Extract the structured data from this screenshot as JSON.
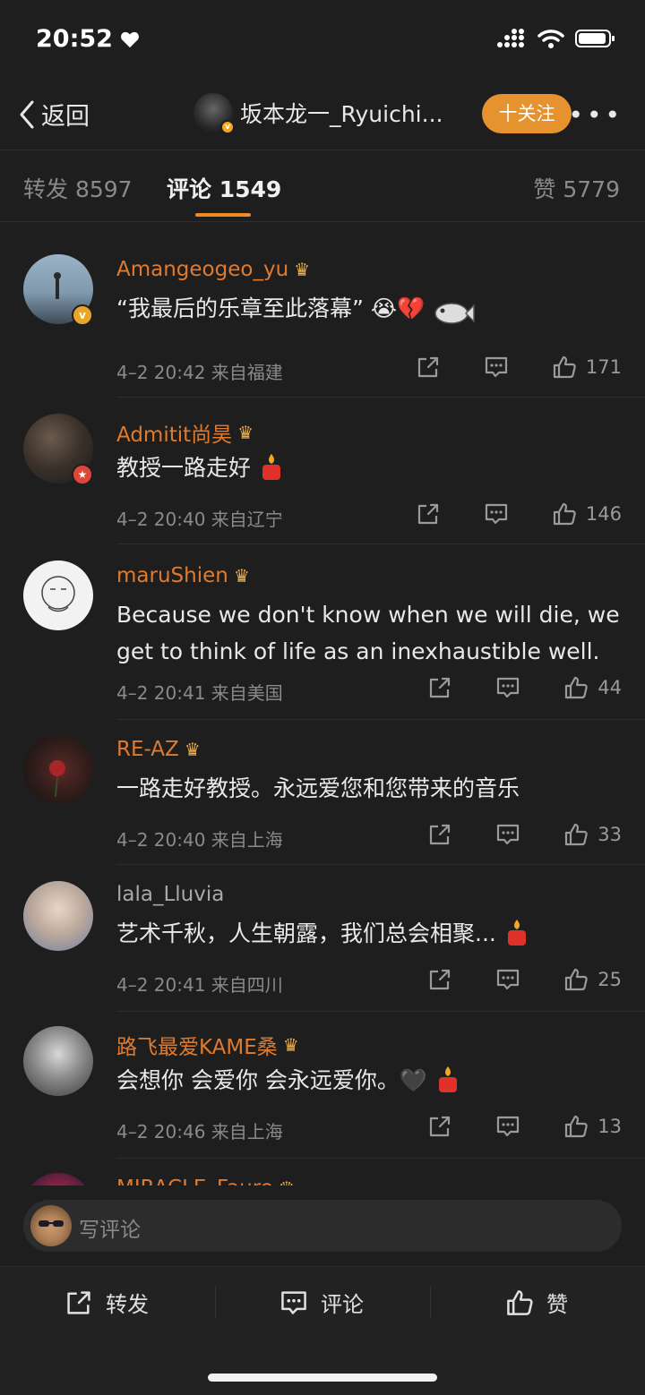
{
  "status_bar": {
    "time": "20:52"
  },
  "nav": {
    "back_label": "返回",
    "user_name": "坂本龙一_Ryuichi...",
    "follow_label": "十关注",
    "more_label": "•••"
  },
  "tabs": [
    {
      "label": "转发 8597"
    },
    {
      "label": "评论 1549"
    },
    {
      "label": "赞 5779"
    }
  ],
  "comments": [
    {
      "name": "Amangeogeo_yu",
      "text": "“我最后的乐章至此落幕”",
      "emojis": "😭💔",
      "meta": "4–2 20:42  来自福建",
      "likes": "171"
    },
    {
      "name": "Admitit尚昊",
      "text": "教授一路走好",
      "meta": "4–2 20:40  来自辽宁",
      "likes": "146"
    },
    {
      "name": "maruShien",
      "text": "Because we don't know when we will die, we get to think of life as an inexhaustible well.",
      "meta": "4–2 20:41  来自美国",
      "likes": "44"
    },
    {
      "name": "RE-AZ",
      "text": "一路走好教授。永远爱您和您带来的音乐",
      "meta": "4–2 20:40  来自上海",
      "likes": "33"
    },
    {
      "name": "lala_Lluvia",
      "text": "艺术千秋，人生朝露，我们总会相聚...",
      "meta": "4–2 20:41  来自四川",
      "likes": "25"
    },
    {
      "name": "路飞最爱KAME桑",
      "text": "会想你 会爱你 会永远爱你。🖤",
      "meta": "4–2 20:46  来自上海",
      "likes": "13"
    },
    {
      "name": "MIRACLE_Faure"
    }
  ],
  "input": {
    "placeholder": "写评论"
  },
  "bottom_bar": {
    "repost_label": "转发",
    "comment_label": "评论",
    "like_label": "赞"
  },
  "colors": {
    "accent": "#e6922f",
    "username": "#e07a2e",
    "background": "#1e1e1e"
  }
}
